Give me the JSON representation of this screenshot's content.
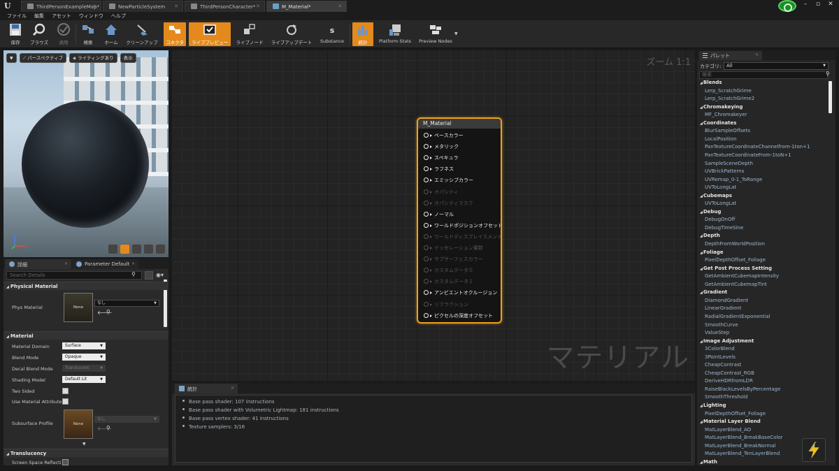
{
  "titlebar": {
    "logo": "U",
    "tabs": [
      {
        "label": "ThirdPersonExampleMap*",
        "active": false
      },
      {
        "label": "NewParticleSystem",
        "active": false
      },
      {
        "label": "ThirdPersonCharacter*",
        "active": false
      },
      {
        "label": "M_Material*",
        "active": true
      }
    ],
    "window_buttons": [
      "–",
      "▫",
      "✕"
    ]
  },
  "menu": [
    "ファイル",
    "編集",
    "アセット",
    "ウィンドウ",
    "ヘルプ"
  ],
  "toolbar": {
    "buttons": [
      {
        "label": "保存",
        "icon": "save-icon",
        "state": "normal"
      },
      {
        "label": "ブラウズ",
        "icon": "browse-icon",
        "state": "normal"
      },
      {
        "label": "適用",
        "icon": "apply-icon",
        "state": "disabled"
      },
      {
        "label": "検索",
        "icon": "search-icon",
        "state": "normal"
      },
      {
        "label": "ホーム",
        "icon": "home-icon",
        "state": "normal"
      },
      {
        "label": "クリーンアップ",
        "icon": "cleanup-icon",
        "state": "normal"
      },
      {
        "label": "コネクタ",
        "icon": "connector-icon",
        "state": "on"
      },
      {
        "label": "ライブプレビュー",
        "icon": "live-preview-icon",
        "state": "on"
      },
      {
        "label": "ライブノード",
        "icon": "live-nodes-icon",
        "state": "normal"
      },
      {
        "label": "ライブアップデート",
        "icon": "live-update-icon",
        "state": "normal"
      },
      {
        "label": "Substance",
        "icon": "substance-icon",
        "state": "normal"
      },
      {
        "label": "統計",
        "icon": "stats-icon",
        "state": "on"
      },
      {
        "label": "Platform Stats",
        "icon": "platform-stats-icon",
        "state": "normal"
      },
      {
        "label": "Preview Nodes",
        "icon": "preview-nodes-icon",
        "state": "normal"
      }
    ]
  },
  "viewport": {
    "perspective_label": "パースペクティブ",
    "lighting_label": "ライティングあり",
    "show_label": "表示",
    "axis_x": "x",
    "axis_z": "z"
  },
  "details": {
    "tabs": [
      "詳細",
      "Parameter Default"
    ],
    "search_placeholder": "Search Details",
    "sections": {
      "physical": "Physical Material",
      "material": "Material",
      "translucency": "Translucency"
    },
    "phys_material": {
      "label": "Phys Material",
      "thumb": "None",
      "value": "なし"
    },
    "rows": [
      {
        "label": "Material Domain",
        "value": "Surface",
        "style": "light"
      },
      {
        "label": "Blend Mode",
        "value": "Opaque",
        "style": "light"
      },
      {
        "label": "Decal Blend Mode",
        "value": "Translucent",
        "style": "dim"
      },
      {
        "label": "Shading Model",
        "value": "Default Lit",
        "style": "light"
      }
    ],
    "checks": [
      {
        "label": "Two Sided",
        "checked": false
      },
      {
        "label": "Use Material Attribute",
        "checked": false
      }
    ],
    "subsurface": {
      "label": "Subsurface Profile",
      "thumb": "None",
      "value": "なし"
    },
    "translucency_row": "Screen Space Reflecti"
  },
  "graph": {
    "zoom": "ズーム 1:1",
    "watermark": "マテリアル",
    "node": {
      "title": "M_Material",
      "pins": [
        {
          "label": "ベースカラー",
          "enabled": true
        },
        {
          "label": "メタリック",
          "enabled": true
        },
        {
          "label": "スペキュラ",
          "enabled": true
        },
        {
          "label": "ラフネス",
          "enabled": true
        },
        {
          "label": "エミッシブカラー",
          "enabled": true
        },
        {
          "label": "オパシティ",
          "enabled": false
        },
        {
          "label": "オパシティマスク",
          "enabled": false
        },
        {
          "label": "ノーマル",
          "enabled": true
        },
        {
          "label": "ワールドポジションオフセット",
          "enabled": true
        },
        {
          "label": "ワールドディスプレイスメント",
          "enabled": false
        },
        {
          "label": "テッセレーション乗数",
          "enabled": false
        },
        {
          "label": "サブサーフェスカラー",
          "enabled": false
        },
        {
          "label": "カスタムデータ０",
          "enabled": false
        },
        {
          "label": "カスタムデータ１",
          "enabled": false
        },
        {
          "label": "アンビエントオクルージョン",
          "enabled": true
        },
        {
          "label": "リフラクション",
          "enabled": false
        },
        {
          "label": "ピクセルの深度オフセット",
          "enabled": true
        }
      ]
    }
  },
  "stats": {
    "tab": "統計",
    "lines": [
      "Base pass shader: 107 instructions",
      "Base pass shader with Volumetric Lightmap: 181 instructions",
      "Base pass vertex shader: 41 instructions",
      "Texture samplers: 3/16"
    ]
  },
  "palette": {
    "tab": "パレット",
    "category_label": "カテゴリ:",
    "category_value": "All",
    "search_placeholder": "検索",
    "items": [
      {
        "t": "cat",
        "label": "Blends"
      },
      {
        "t": "leaf",
        "label": "Lerp_ScratchGrime"
      },
      {
        "t": "leaf",
        "label": "Lerp_ScratchGrime2"
      },
      {
        "t": "cat",
        "label": "Chromakeying"
      },
      {
        "t": "leaf",
        "label": "MF_Chromakeyer"
      },
      {
        "t": "cat",
        "label": "Coordinates"
      },
      {
        "t": "leaf",
        "label": "BlurSampleOffsets"
      },
      {
        "t": "leaf",
        "label": "LocalPosition"
      },
      {
        "t": "leaf",
        "label": "PanTextureCoordinateChannelfrom-1ton+1"
      },
      {
        "t": "leaf",
        "label": "PanTextureCoordinateFrom-1toN+1"
      },
      {
        "t": "leaf",
        "label": "SampleSceneDepth"
      },
      {
        "t": "leaf",
        "label": "UVBrickPatterns"
      },
      {
        "t": "leaf",
        "label": "UVRemap_0-1_ToRange"
      },
      {
        "t": "leaf",
        "label": "UVToLongLat"
      },
      {
        "t": "cat",
        "label": "Cubemaps"
      },
      {
        "t": "leaf",
        "label": "UVToLongLat"
      },
      {
        "t": "cat",
        "label": "Debug"
      },
      {
        "t": "leaf",
        "label": "DebugOnOff"
      },
      {
        "t": "leaf",
        "label": "DebugTimeSine"
      },
      {
        "t": "cat",
        "label": "Depth"
      },
      {
        "t": "leaf",
        "label": "DepthFromWorldPosition"
      },
      {
        "t": "cat",
        "label": "Foliage"
      },
      {
        "t": "leaf",
        "label": "PixelDepthOffset_Foliage"
      },
      {
        "t": "cat",
        "label": "Get Post Process Setting"
      },
      {
        "t": "leaf",
        "label": "GetAmbientCubemapIntensity"
      },
      {
        "t": "leaf",
        "label": "GetAmbientCubemapTint"
      },
      {
        "t": "cat",
        "label": "Gradient"
      },
      {
        "t": "leaf",
        "label": "DiamondGradient"
      },
      {
        "t": "leaf",
        "label": "LinearGradient"
      },
      {
        "t": "leaf",
        "label": "RadialGradientExponential"
      },
      {
        "t": "leaf",
        "label": "SmoothCurve"
      },
      {
        "t": "leaf",
        "label": "ValueStep"
      },
      {
        "t": "cat",
        "label": "Image Adjustment"
      },
      {
        "t": "leaf",
        "label": "3ColorBlend"
      },
      {
        "t": "leaf",
        "label": "3PointLevels"
      },
      {
        "t": "leaf",
        "label": "CheapContrast"
      },
      {
        "t": "leaf",
        "label": "CheapContrast_RGB"
      },
      {
        "t": "leaf",
        "label": "DeriveHDRfromLDR"
      },
      {
        "t": "leaf",
        "label": "RaiseBlackLevelsByPercentage"
      },
      {
        "t": "leaf",
        "label": "SmoothThreshold"
      },
      {
        "t": "cat",
        "label": "Lighting"
      },
      {
        "t": "leaf",
        "label": "PixelDepthOffset_Foliage"
      },
      {
        "t": "cat",
        "label": "Material Layer Blend"
      },
      {
        "t": "leaf",
        "label": "MatLayerBlend_AO"
      },
      {
        "t": "leaf",
        "label": "MatLayerBlend_BreakBaseColor"
      },
      {
        "t": "leaf",
        "label": "MatLayerBlend_BreakNormal"
      },
      {
        "t": "leaf",
        "label": "MatLayerBlend_TenLayerBlend"
      },
      {
        "t": "cat",
        "label": "Math"
      }
    ]
  },
  "colors": {
    "accent": "#e48a1c",
    "node_border": "#f0a020",
    "palette_leaf": "#9cb8d2"
  }
}
